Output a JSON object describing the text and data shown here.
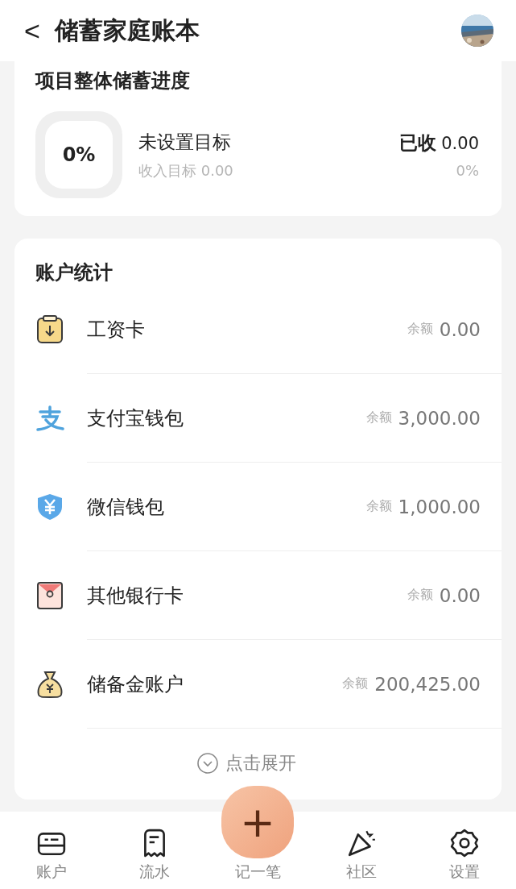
{
  "header": {
    "back": "<",
    "title": "储蓄家庭账本"
  },
  "progress": {
    "title": "项目整体储蓄进度",
    "percent": "0%",
    "goal_status": "未设置目标",
    "goal_text": "收入目标 0.00",
    "received_label": "已收",
    "received_value": "0.00",
    "received_percent": "0%"
  },
  "accounts": {
    "title": "账户统计",
    "items": [
      {
        "kind": "salary",
        "name": "工资卡",
        "balance_label": "余额",
        "balance": "0.00"
      },
      {
        "kind": "alipay",
        "name": "支付宝钱包",
        "balance_label": "余额",
        "balance": "3,000.00"
      },
      {
        "kind": "wechat",
        "name": "微信钱包",
        "balance_label": "余额",
        "balance": "1,000.00"
      },
      {
        "kind": "bank",
        "name": "其他银行卡",
        "balance_label": "余额",
        "balance": "0.00"
      },
      {
        "kind": "reserve",
        "name": "储备金账户",
        "balance_label": "余额",
        "balance": "200,425.00"
      }
    ],
    "expand": "点击展开"
  },
  "fab": {
    "symbol": "+"
  },
  "tabs": [
    {
      "kind": "account",
      "label": "账户",
      "selected": false
    },
    {
      "kind": "flow",
      "label": "流水",
      "selected": false
    },
    {
      "kind": "record",
      "label": "记一笔",
      "selected": false
    },
    {
      "kind": "community",
      "label": "社区",
      "selected": false
    },
    {
      "kind": "settings",
      "label": "设置",
      "selected": false
    }
  ]
}
